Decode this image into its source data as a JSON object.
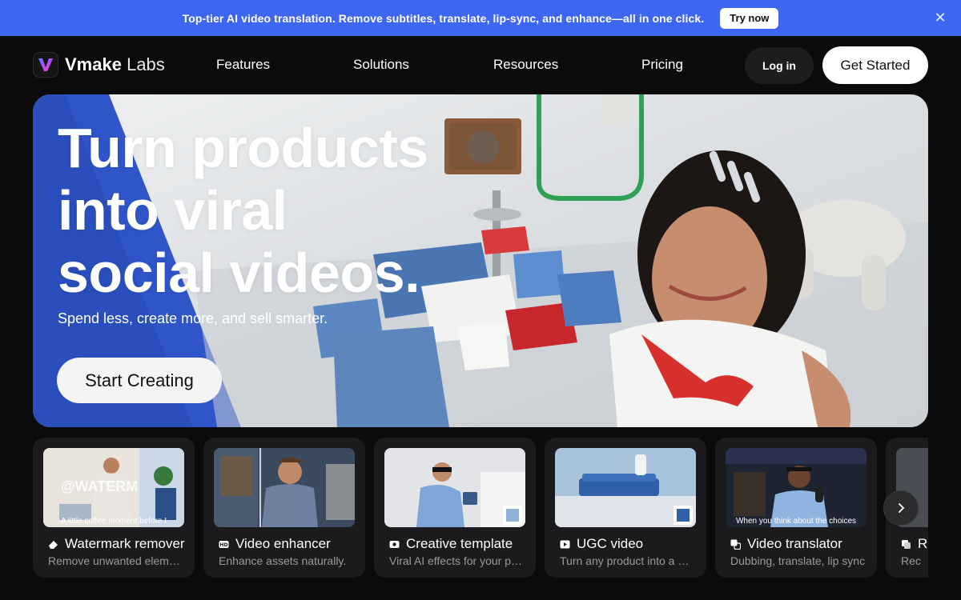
{
  "promo": {
    "text": "Top-tier AI video translation. Remove subtitles, translate, lip-sync, and enhance—all in one click.",
    "button": "Try now",
    "close_icon": "close-icon"
  },
  "nav": {
    "brand_bold": "Vmake",
    "brand_light": "Labs",
    "links": [
      "Features",
      "Solutions",
      "Resources",
      "Pricing"
    ],
    "login": "Log in",
    "get_started": "Get Started"
  },
  "hero": {
    "title_lines": [
      "Turn products",
      "into viral",
      "social videos."
    ],
    "subtitle": "Spend less, create more, and sell smarter.",
    "cta": "Start Creating"
  },
  "cards": [
    {
      "title": "Watermark remover",
      "desc": "Remove unwanted elements",
      "icon": "eraser-icon",
      "overlay": "@WATERM",
      "caption": "A little coffee moment before I"
    },
    {
      "title": "Video enhancer",
      "desc": "Enhance assets naturally.",
      "icon": "hd-icon"
    },
    {
      "title": "Creative template",
      "desc": "Viral AI effects for your products",
      "icon": "template-icon"
    },
    {
      "title": "UGC video",
      "desc": "Turn any product into a UGC video",
      "icon": "ugc-icon"
    },
    {
      "title": "Video translator",
      "desc": "Dubbing, translate, lip sync",
      "icon": "translate-icon",
      "caption": "When you think about the choices"
    },
    {
      "title": "R",
      "desc": "Rec",
      "icon": "layers-icon"
    }
  ],
  "colors": {
    "accent": "#3d66f2",
    "page_bg": "#0b0b0c",
    "card_bg": "#1b1b1d"
  }
}
